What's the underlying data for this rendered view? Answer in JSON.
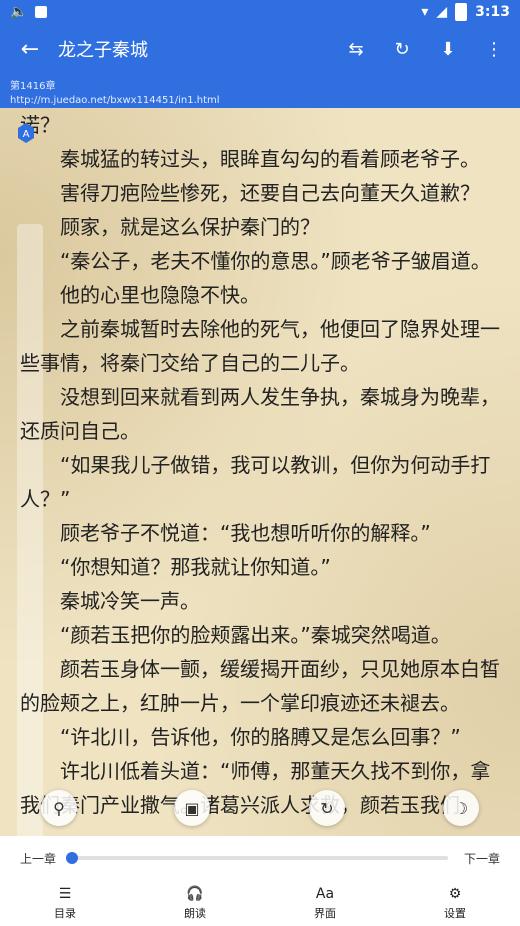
{
  "status_bar": {
    "time": "3:13",
    "icons": [
      "volume-icon",
      "notification-square-icon",
      "wifi-icon",
      "cell-signal-icon",
      "battery-icon"
    ]
  },
  "app_bar": {
    "title": "龙之子秦城",
    "back_icon": "arrow-left-icon",
    "actions": [
      "shuffle-icon",
      "refresh-icon",
      "download-icon",
      "more-vert-icon"
    ]
  },
  "chapter": {
    "label": "第1416章",
    "url": "http://m.juedao.net/bxwx114451/in1.html"
  },
  "reader": {
    "fragment": "诺？",
    "paragraphs": [
      "秦城猛的转过头，眼眸直勾勾的看着顾老爷子。",
      "害得刀疤险些惨死，还要自己去向董天久道歉？",
      "顾家，就是这么保护秦门的？",
      "“秦公子，老夫不懂你的意思。”顾老爷子皱眉道。",
      "他的心里也隐隐不快。",
      "之前秦城暂时去除他的死气，他便回了隐界处理一些事情，将秦门交给了自己的二儿子。",
      "没想到回来就看到两人发生争执，秦城身为晚辈，还质问自己。",
      "“如果我儿子做错，我可以教训，但你为何动手打人？”",
      "顾老爷子不悦道：“我也想听听你的解释。”",
      "“你想知道？那我就让你知道。”",
      "秦城冷笑一声。",
      "“颜若玉把你的脸颊露出来。”秦城突然喝道。",
      "颜若玉身体一颤，缓缓揭开面纱，只见她原本白皙的脸颊之上，红肿一片，一个掌印痕迹还未褪去。",
      "“许北川，告诉他，你的胳膊又是怎么回事？”",
      "许北川低着头道：“师傅，那董天久找不到你，拿我们秦门产业撒气。诸葛兴派人求救，颜若玉我们"
    ]
  },
  "floating_buttons": [
    "search-icon",
    "page-icon",
    "replace-icon",
    "night-mode-icon"
  ],
  "progress": {
    "prev_label": "上一章",
    "next_label": "下一章",
    "value": 0.0
  },
  "bottom_nav": [
    {
      "label": "目录",
      "icon": "list-icon"
    },
    {
      "label": "朗读",
      "icon": "headphones-icon"
    },
    {
      "label": "界面",
      "icon": "font-icon"
    },
    {
      "label": "设置",
      "icon": "settings-icon"
    }
  ],
  "colors": {
    "primary": "#2f6fe0",
    "paper": "#efe3c2"
  }
}
